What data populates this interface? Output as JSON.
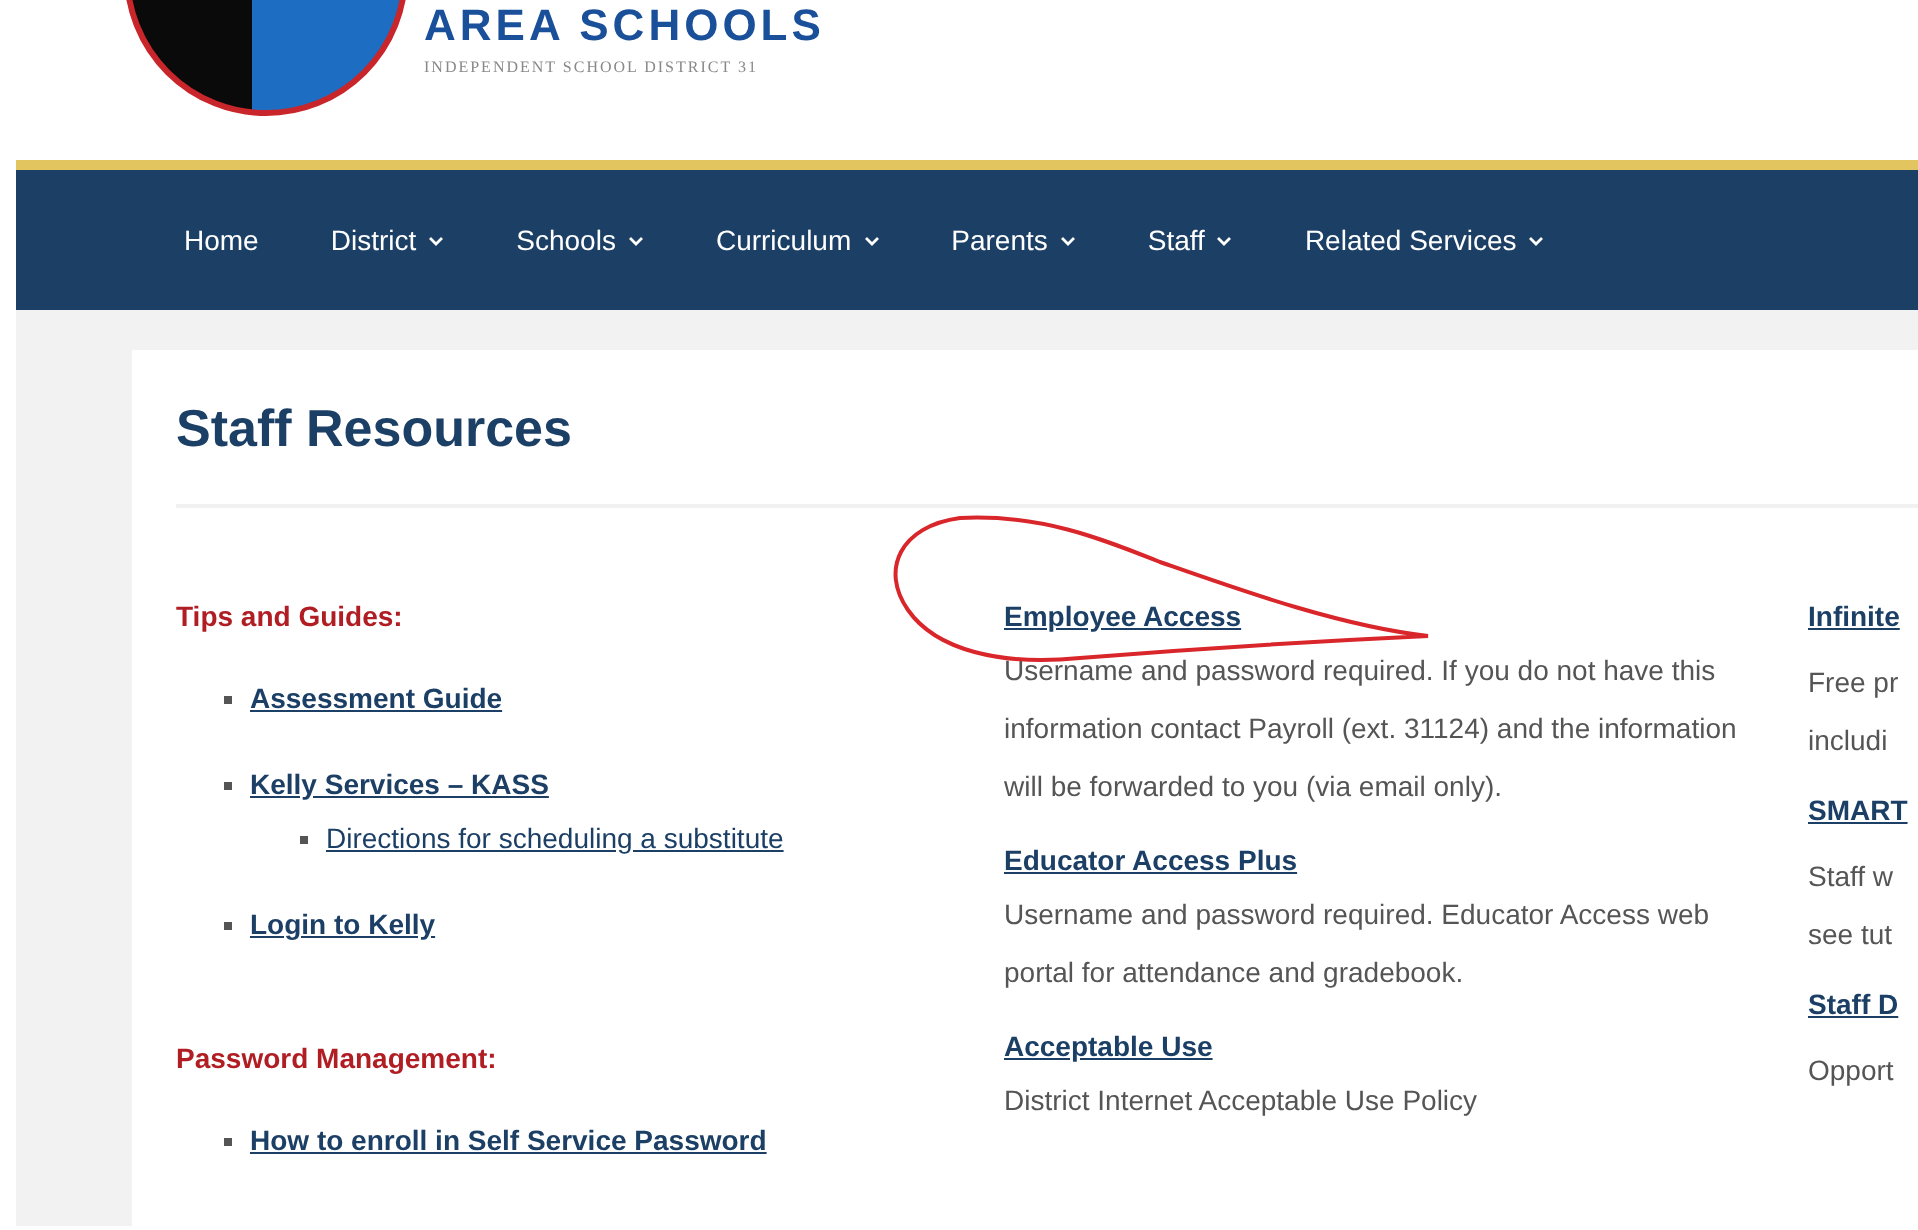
{
  "header": {
    "logo_title": "AREA SCHOOLS",
    "logo_subtitle": "INDEPENDENT SCHOOL DISTRICT 31"
  },
  "nav": [
    {
      "label": "Home",
      "dropdown": false
    },
    {
      "label": "District",
      "dropdown": true
    },
    {
      "label": "Schools",
      "dropdown": true
    },
    {
      "label": "Curriculum",
      "dropdown": true
    },
    {
      "label": "Parents",
      "dropdown": true
    },
    {
      "label": "Staff",
      "dropdown": true
    },
    {
      "label": "Related Services",
      "dropdown": true
    }
  ],
  "page_title": "Staff Resources",
  "left_column": [
    {
      "heading": "Tips and Guides:",
      "links": [
        {
          "label": "Assessment Guide"
        },
        {
          "label": "Kelly Services – KASS",
          "children": [
            {
              "label": "Directions for scheduling a substitute"
            }
          ]
        },
        {
          "label": "Login to Kelly"
        }
      ]
    },
    {
      "heading": "Password Management:",
      "links": [
        {
          "label": "How to enroll in Self Service Password"
        }
      ]
    }
  ],
  "middle_column": [
    {
      "title": "Employee Access",
      "description": "Username and password required. If you do not have this information contact Payroll (ext. 31124) and the information will be forwarded to you (via email only)."
    },
    {
      "title": "Educator Access Plus",
      "description": "Username and password required.  Educator Access web portal for attendance and gradebook."
    },
    {
      "title": "Acceptable Use",
      "description": "District Internet Acceptable Use Policy"
    }
  ],
  "right_column": [
    {
      "title": "Infinite",
      "lines": [
        "Free pr",
        "includi"
      ]
    },
    {
      "title": "SMART",
      "lines": [
        "Staff w",
        "see tut"
      ]
    },
    {
      "title": "Staff D",
      "lines": [
        "Opport"
      ]
    }
  ]
}
